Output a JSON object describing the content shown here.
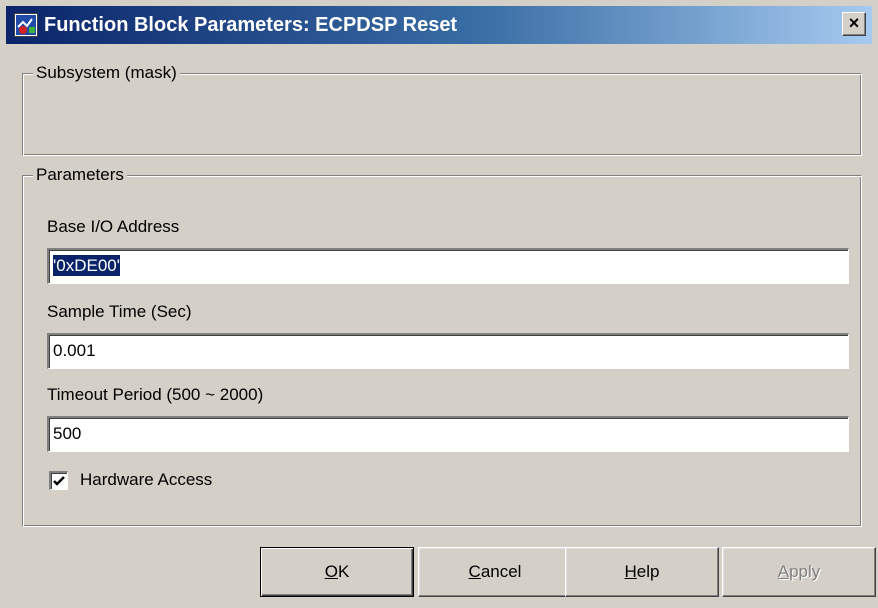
{
  "window": {
    "title": "Function Block Parameters: ECPDSP Reset"
  },
  "subsystem": {
    "legend": "Subsystem (mask)"
  },
  "parameters": {
    "legend": "Parameters",
    "base_io_address": {
      "label": "Base I/O Address",
      "value": "'0xDE00'"
    },
    "sample_time": {
      "label": "Sample Time (Sec)",
      "value": "0.001"
    },
    "timeout_period": {
      "label": "Timeout Period (500 ~ 2000)",
      "value": "500"
    },
    "hardware_access": {
      "label": "Hardware Access",
      "checked": true
    }
  },
  "buttons": {
    "ok": {
      "mnemonic": "O",
      "rest": "K"
    },
    "cancel": {
      "mnemonic": "C",
      "rest": "ancel"
    },
    "help": {
      "mnemonic": "H",
      "rest": "elp"
    },
    "apply": {
      "mnemonic": "A",
      "rest": "pply",
      "enabled": false
    }
  },
  "icons": {
    "app": "simulink-block-icon",
    "close": "close-icon",
    "check": "checkmark-icon"
  },
  "colors": {
    "titlebar_start": "#0a246a",
    "titlebar_end": "#a6caf0",
    "dialog_bg": "#d4d0c8",
    "selection": "#0a246a"
  }
}
